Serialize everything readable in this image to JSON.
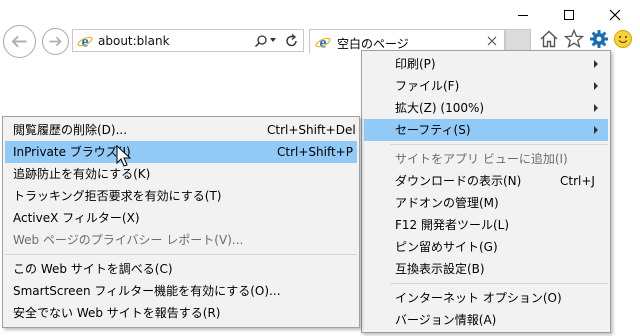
{
  "address_bar": {
    "url": "about:blank"
  },
  "tab": {
    "title": "空白のページ"
  },
  "colors": {
    "highlight": "#91c9f7",
    "menu_bg": "#f2f2f2",
    "gear": "#1b6bb5",
    "ie_blue": "#1e73d6"
  },
  "tools_menu": {
    "items": [
      {
        "label": "印刷(P)"
      },
      {
        "label": "ファイル(F)"
      },
      {
        "label": "拡大(Z) (100%)"
      },
      {
        "label": "セーフティ(S)"
      },
      {
        "label": "サイトをアプリ ビューに追加(I)"
      },
      {
        "label": "ダウンロードの表示(N)",
        "shortcut": "Ctrl+J"
      },
      {
        "label": "アドオンの管理(M)"
      },
      {
        "label": "F12 開発者ツール(L)"
      },
      {
        "label": "ピン留めサイト(G)"
      },
      {
        "label": "互換表示設定(B)"
      },
      {
        "label": "インターネット オプション(O)"
      },
      {
        "label": "バージョン情報(A)"
      }
    ]
  },
  "safety_menu": {
    "items": [
      {
        "label": "閲覧履歴の削除(D)...",
        "shortcut": "Ctrl+Shift+Del"
      },
      {
        "label": "InPrivate ブラウズ(I)",
        "shortcut": "Ctrl+Shift+P"
      },
      {
        "label": "追跡防止を有効にする(K)"
      },
      {
        "label": "トラッキング拒否要求を有効にする(T)"
      },
      {
        "label": "ActiveX フィルター(X)"
      },
      {
        "label": "Web ページのプライバシー レポート(V)..."
      },
      {
        "label": "この Web サイトを調べる(C)"
      },
      {
        "label": "SmartScreen フィルター機能を有効にする(O)..."
      },
      {
        "label": "安全でない Web サイトを報告する(R)"
      }
    ]
  }
}
